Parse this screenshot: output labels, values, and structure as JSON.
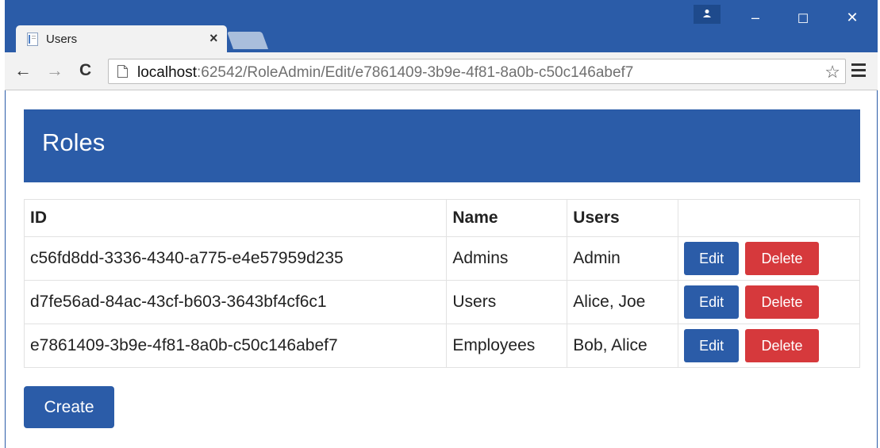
{
  "browser": {
    "tab_title": "Users",
    "tab_close": "×",
    "url_host": "localhost",
    "url_path": ":62542/RoleAdmin/Edit/e7861409-3b9e-4f81-8a0b-c50c146abef7",
    "back": "←",
    "forward": "→",
    "reload": "C",
    "star": "☆",
    "minimize": "–",
    "maximize": "☐",
    "close": "✕"
  },
  "page": {
    "title": "Roles",
    "table": {
      "headers": [
        "ID",
        "Name",
        "Users",
        ""
      ],
      "rows": [
        {
          "id": "c56fd8dd-3336-4340-a775-e4e57959d235",
          "name": "Admins",
          "users": "Admin"
        },
        {
          "id": "d7fe56ad-84ac-43cf-b603-3643bf4cf6c1",
          "name": "Users",
          "users": "Alice, Joe"
        },
        {
          "id": "e7861409-3b9e-4f81-8a0b-c50c146abef7",
          "name": "Employees",
          "users": "Bob, Alice"
        }
      ],
      "edit_label": "Edit",
      "delete_label": "Delete"
    },
    "create_label": "Create"
  },
  "colors": {
    "accent": "#2b5ca8",
    "danger": "#d6393c"
  }
}
